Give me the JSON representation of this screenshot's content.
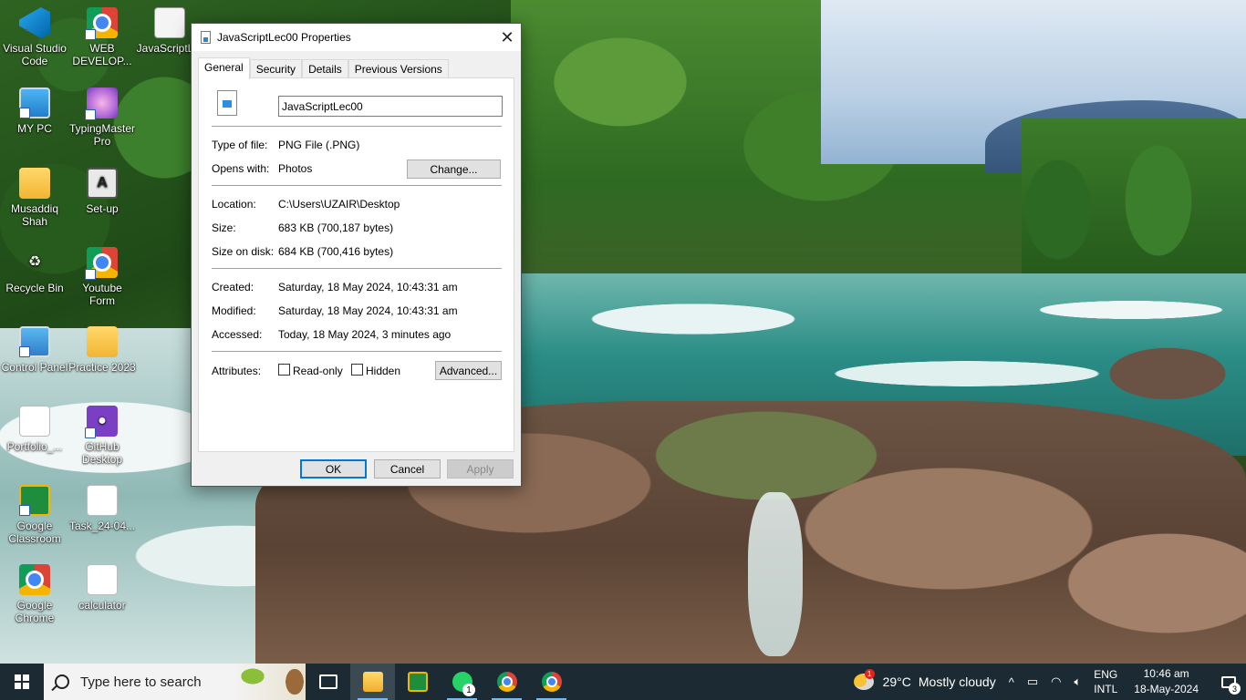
{
  "desktop": {
    "icons": [
      {
        "label": "Visual Studio Code",
        "icon": "vscode-icon"
      },
      {
        "label": "WEB DEVELOP...",
        "icon": "chrome-icon"
      },
      {
        "label": "JavaScriptL...",
        "icon": "image-file-icon"
      },
      {
        "label": "MY  PC",
        "icon": "computer-icon"
      },
      {
        "label": "TypingMaster Pro",
        "icon": "typingmaster-icon"
      },
      {
        "label": "Musaddiq Shah",
        "icon": "user-folder-icon"
      },
      {
        "label": "Set-up",
        "icon": "setup-icon"
      },
      {
        "label": "Recycle Bin",
        "icon": "recycle-bin-icon"
      },
      {
        "label": "Youtube Form",
        "icon": "chrome-icon"
      },
      {
        "label": "Control Panel",
        "icon": "control-panel-icon"
      },
      {
        "label": "Practice 2023",
        "icon": "folder-icon"
      },
      {
        "label": "Portfolio_...",
        "icon": "html-file-icon"
      },
      {
        "label": "GitHub Desktop",
        "icon": "github-icon"
      },
      {
        "label": "Google Classroom",
        "icon": "classroom-icon"
      },
      {
        "label": "Task_24-04...",
        "icon": "html-file-icon"
      },
      {
        "label": "Google Chrome",
        "icon": "chrome-icon"
      },
      {
        "label": "calculator",
        "icon": "html-file-icon"
      }
    ]
  },
  "dialog": {
    "title": "JavaScriptLec00 Properties",
    "close_glyph": "✕",
    "tabs": [
      {
        "label": "General",
        "active": true
      },
      {
        "label": "Security",
        "active": false
      },
      {
        "label": "Details",
        "active": false
      },
      {
        "label": "Previous Versions",
        "active": false
      }
    ],
    "file_name": "JavaScriptLec00",
    "type_label": "Type of file:",
    "type_value": "PNG File (.PNG)",
    "opens_label": "Opens with:",
    "opens_value": "Photos",
    "change_button": "Change...",
    "location_label": "Location:",
    "location_value": "C:\\Users\\UZAIR\\Desktop",
    "size_label": "Size:",
    "size_value": "683 KB (700,187 bytes)",
    "size_disk_label": "Size on disk:",
    "size_disk_value": "684 KB (700,416 bytes)",
    "created_label": "Created:",
    "created_value": "Saturday, 18 May 2024, 10:43:31 am",
    "modified_label": "Modified:",
    "modified_value": "Saturday, 18 May 2024, 10:43:31 am",
    "accessed_label": "Accessed:",
    "accessed_value": "Today, 18 May 2024, 3 minutes ago",
    "attributes_label": "Attributes:",
    "readonly_label": "Read-only",
    "readonly_checked": false,
    "hidden_label": "Hidden",
    "hidden_checked": false,
    "advanced_button": "Advanced...",
    "ok_button": "OK",
    "cancel_button": "Cancel",
    "apply_button": "Apply"
  },
  "taskbar": {
    "search_placeholder": "Type here to search",
    "apps": [
      {
        "name": "task-view",
        "open": false,
        "active": false
      },
      {
        "name": "file-explorer",
        "open": true,
        "active": true
      },
      {
        "name": "google-classroom",
        "open": false,
        "active": false
      },
      {
        "name": "whatsapp",
        "open": true,
        "active": false,
        "badge": "1"
      },
      {
        "name": "chrome",
        "open": true,
        "active": false
      },
      {
        "name": "chrome-profile-2",
        "open": true,
        "active": false
      }
    ],
    "weather": {
      "badge": "1",
      "temp": "29°C",
      "condition": "Mostly cloudy"
    },
    "tray": {
      "chevron": "^"
    },
    "lang_top": "ENG",
    "lang_bottom": "INTL",
    "time": "10:46 am",
    "date": "18-May-2024",
    "notification_count": "3"
  },
  "colors": {
    "accent": "#0078d7",
    "taskbar_bg": "#1c2b33",
    "dialog_bg": "#f0f0f0"
  }
}
